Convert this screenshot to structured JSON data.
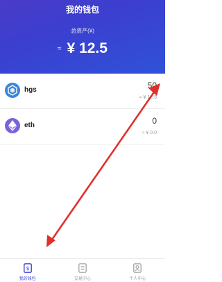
{
  "header": {
    "title": "我的钱包",
    "subtitle": "总资产(¥)",
    "approx": "≈",
    "total": "¥ 12.5"
  },
  "assets": [
    {
      "name": "hgs",
      "quantity": "50",
      "value": "≈ ¥ 12.5",
      "icon": "hgs-token-icon",
      "color": "#3a86d8"
    },
    {
      "name": "eth",
      "quantity": "0",
      "value": "≈ ¥ 0.0",
      "icon": "ethereum-icon",
      "color": "#7b62d9"
    }
  ],
  "tabs": [
    {
      "label": "我的钱包",
      "icon": "wallet-icon",
      "active": true
    },
    {
      "label": "交易中心",
      "icon": "document-icon",
      "active": false
    },
    {
      "label": "个人中心",
      "icon": "user-icon",
      "active": false
    }
  ],
  "annotation_color": "#e0302c"
}
